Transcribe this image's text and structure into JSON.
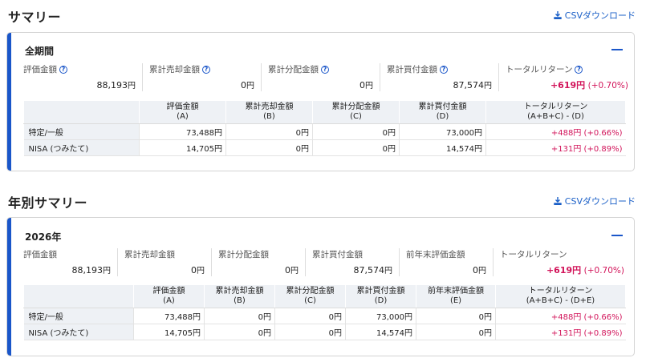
{
  "summary": {
    "title": "サマリー",
    "csv_label": "CSVダウンロード",
    "card_title": "全期間",
    "metrics": [
      {
        "label": "評価金額",
        "value": "88,193",
        "unit": "円",
        "help": true
      },
      {
        "label": "累計売却金額",
        "value": "0",
        "unit": "円",
        "help": true
      },
      {
        "label": "累計分配金額",
        "value": "0",
        "unit": "円",
        "help": true
      },
      {
        "label": "累計買付金額",
        "value": "87,574",
        "unit": "円",
        "help": true
      },
      {
        "label": "トータルリターン",
        "value": "+619",
        "unit": "円",
        "pct": "(+0.70%)",
        "help": true
      }
    ],
    "table": {
      "headers": [
        {
          "top": "",
          "bottom": ""
        },
        {
          "top": "評価金額",
          "bottom": "(A)"
        },
        {
          "top": "累計売却金額",
          "bottom": "(B)"
        },
        {
          "top": "累計分配金額",
          "bottom": "(C)"
        },
        {
          "top": "累計買付金額",
          "bottom": "(D)"
        },
        {
          "top": "トータルリターン",
          "bottom": "(A+B+C) - (D)"
        }
      ],
      "rows": [
        {
          "label": "特定/一般",
          "cells": [
            "73,488円",
            "0円",
            "0円",
            "73,000円"
          ],
          "ret": "+488円 (+0.66%)"
        },
        {
          "label": "NISA (つみたて)",
          "cells": [
            "14,705円",
            "0円",
            "0円",
            "14,574円"
          ],
          "ret": "+131円 (+0.89%)"
        }
      ]
    }
  },
  "yearly": {
    "title": "年別サマリー",
    "csv_label": "CSVダウンロード",
    "card_title": "2026年",
    "metrics": [
      {
        "label": "評価金額",
        "value": "88,193",
        "unit": "円"
      },
      {
        "label": "累計売却金額",
        "value": "0",
        "unit": "円"
      },
      {
        "label": "累計分配金額",
        "value": "0",
        "unit": "円"
      },
      {
        "label": "累計買付金額",
        "value": "87,574",
        "unit": "円"
      },
      {
        "label": "前年末評価金額",
        "value": "0",
        "unit": "円"
      },
      {
        "label": "トータルリターン",
        "value": "+619",
        "unit": "円",
        "pct": "(+0.70%)"
      }
    ],
    "table": {
      "headers": [
        {
          "top": "",
          "bottom": ""
        },
        {
          "top": "評価金額",
          "bottom": "(A)"
        },
        {
          "top": "累計売却金額",
          "bottom": "(B)"
        },
        {
          "top": "累計分配金額",
          "bottom": "(C)"
        },
        {
          "top": "累計買付金額",
          "bottom": "(D)"
        },
        {
          "top": "前年末評価金額",
          "bottom": "(E)"
        },
        {
          "top": "トータルリターン",
          "bottom": "(A+B+C) - (D+E)"
        }
      ],
      "rows": [
        {
          "label": "特定/一般",
          "cells": [
            "73,488円",
            "0円",
            "0円",
            "73,000円",
            "0円"
          ],
          "ret": "+488円 (+0.66%)"
        },
        {
          "label": "NISA (つみたて)",
          "cells": [
            "14,705円",
            "0円",
            "0円",
            "14,574円",
            "0円"
          ],
          "ret": "+131円 (+0.89%)"
        }
      ]
    }
  },
  "colors": {
    "accent": "#1a56c9",
    "positive": "#d2145a",
    "header_bg": "#eef1f5"
  }
}
